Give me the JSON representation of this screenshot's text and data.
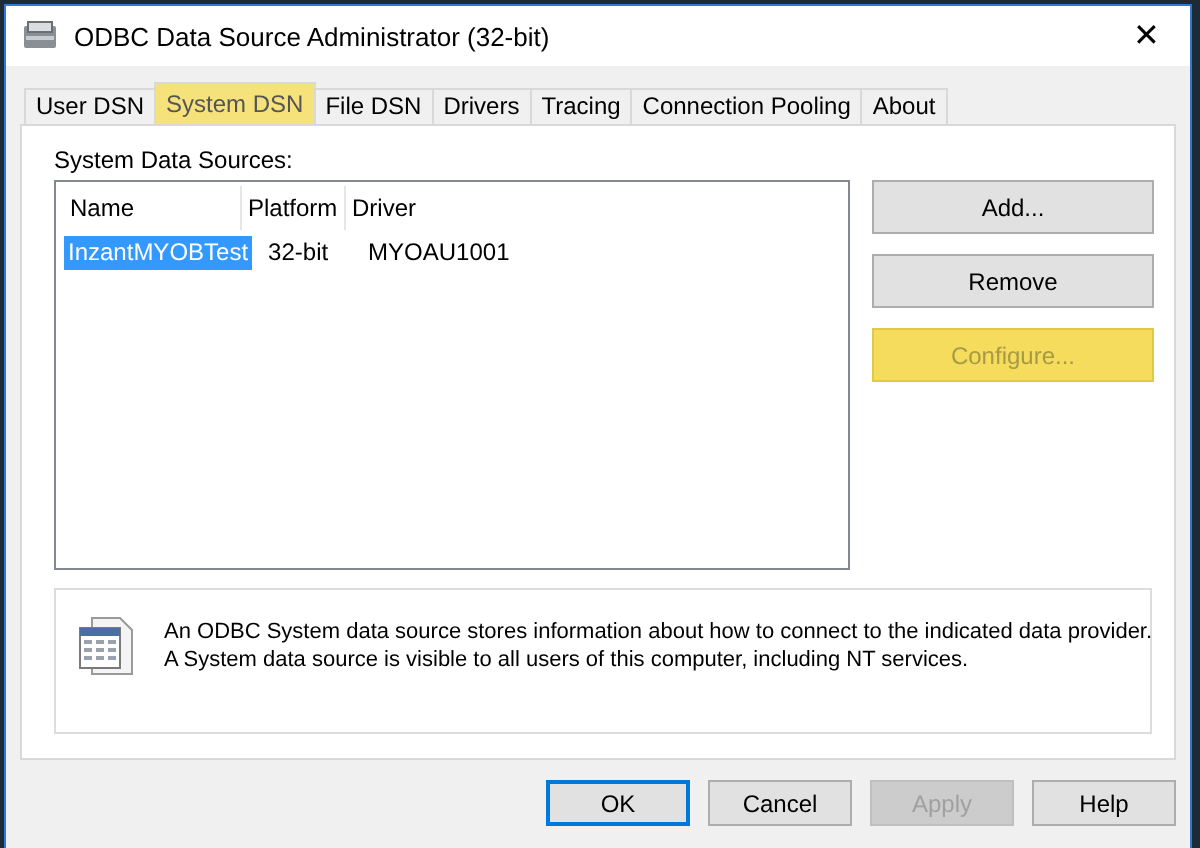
{
  "window": {
    "title": "ODBC Data Source Administrator (32-bit)",
    "close": "✕"
  },
  "tabs": [
    {
      "label": "User DSN",
      "selected": false,
      "highlighted": false
    },
    {
      "label": "System DSN",
      "selected": true,
      "highlighted": true
    },
    {
      "label": "File DSN",
      "selected": false,
      "highlighted": false
    },
    {
      "label": "Drivers",
      "selected": false,
      "highlighted": false
    },
    {
      "label": "Tracing",
      "selected": false,
      "highlighted": false
    },
    {
      "label": "Connection Pooling",
      "selected": false,
      "highlighted": false
    },
    {
      "label": "About",
      "selected": false,
      "highlighted": false
    }
  ],
  "list_label": "System Data Sources:",
  "table": {
    "columns": [
      "Name",
      "Platform",
      "Driver"
    ],
    "rows": [
      {
        "cells": [
          "InzantMYOBTest",
          "32-bit",
          "MYOAU1001"
        ],
        "selected": true
      }
    ]
  },
  "side_buttons": [
    {
      "label": "Add...",
      "disabled": false,
      "highlighted": false
    },
    {
      "label": "Remove",
      "disabled": false,
      "highlighted": false
    },
    {
      "label": "Configure...",
      "disabled": true,
      "highlighted": true
    }
  ],
  "info": [
    "An ODBC System data source stores information about how to connect to the indicated data provider.",
    "A System data source is visible to all users of this computer, including NT services."
  ],
  "footer_buttons": [
    {
      "label": "OK",
      "disabled": false,
      "default": true
    },
    {
      "label": "Cancel",
      "disabled": false,
      "default": false
    },
    {
      "label": "Apply",
      "disabled": true,
      "default": false
    },
    {
      "label": "Help",
      "disabled": false,
      "default": false
    }
  ]
}
